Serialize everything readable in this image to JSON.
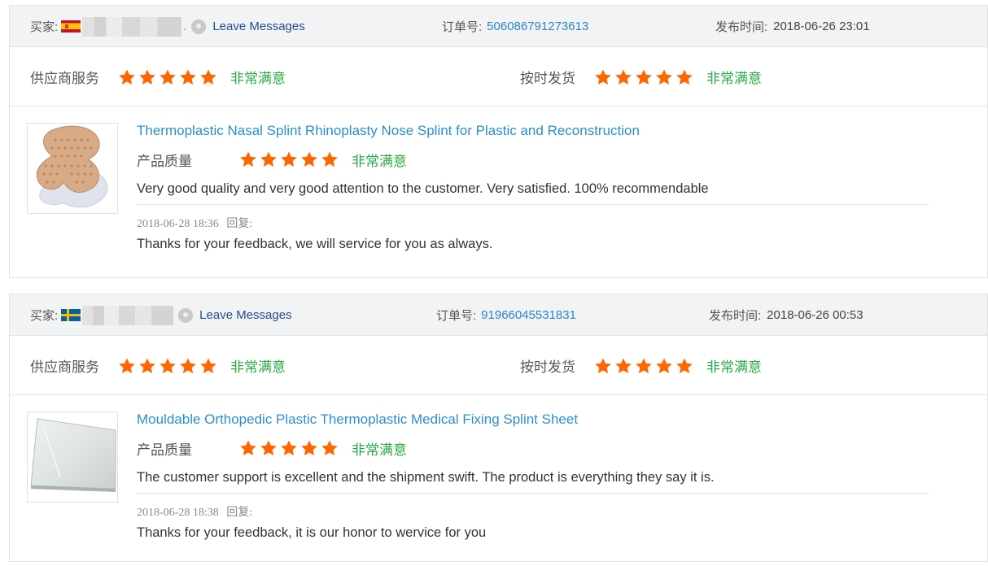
{
  "colors": {
    "star": "#ff6600",
    "satisfied": "#27a844",
    "link": "#2a86c4",
    "leave_messages": "#1f4f8a",
    "header_bg": "#f2f3f5"
  },
  "reviews": [
    {
      "buyer_label": "买家:",
      "buyer_country_flag": "spain-flag",
      "leave_messages": "Leave Messages",
      "order_label": "订单号:",
      "order_no": "506086791273613",
      "time_label": "发布时间:",
      "time": "2018-06-26 23:01",
      "supplier_service": {
        "label": "供应商服务",
        "rating": 5,
        "text": "非常满意"
      },
      "on_time_delivery": {
        "label": "按时发货",
        "rating": 5,
        "text": "非常满意"
      },
      "product": {
        "title": "Thermoplastic Nasal Splint Rhinoplasty Nose Splint for Plastic and Reconstruction",
        "quality_label": "产品质量",
        "quality_rating": 5,
        "quality_text": "非常满意",
        "image": "nasal-splint-image"
      },
      "comment": "Very good quality and very good attention to the customer. Very satisfied. 100% recommendable",
      "reply_time": "2018-06-28 18:36",
      "reply_label": "回复:",
      "reply": "Thanks for your feedback, we will service for you as always."
    },
    {
      "buyer_label": "买家:",
      "buyer_country_flag": "sweden-flag",
      "leave_messages": "Leave Messages",
      "order_label": "订单号:",
      "order_no": "91966045531831",
      "time_label": "发布时间:",
      "time": "2018-06-26 00:53",
      "supplier_service": {
        "label": "供应商服务",
        "rating": 5,
        "text": "非常满意"
      },
      "on_time_delivery": {
        "label": "按时发货",
        "rating": 5,
        "text": "非常满意"
      },
      "product": {
        "title": "Mouldable Orthopedic Plastic Thermoplastic Medical Fixing Splint Sheet",
        "quality_label": "产品质量",
        "quality_rating": 5,
        "quality_text": "非常满意",
        "image": "splint-sheet-image"
      },
      "comment": "The customer support is excellent and the shipment swift. The product is everything they say it is.",
      "reply_time": "2018-06-28 18:38",
      "reply_label": "回复:",
      "reply": "Thanks for your feedback, it is our honor to wervice for you"
    }
  ]
}
